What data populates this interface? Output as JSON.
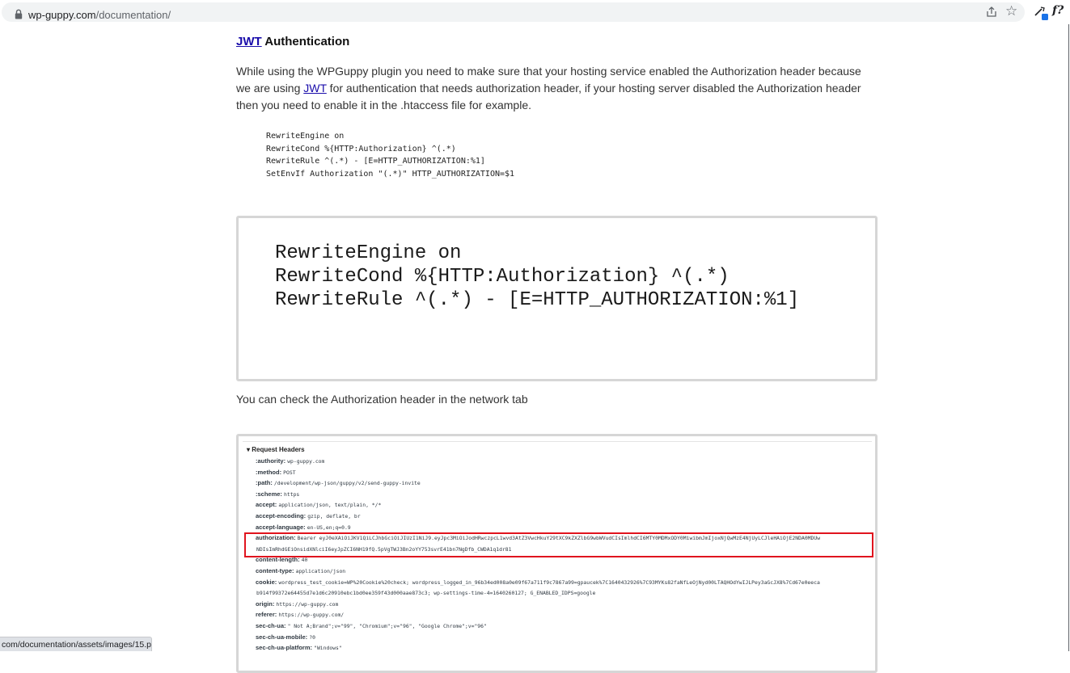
{
  "browser": {
    "url_domain": "wp-guppy.com",
    "url_path": "/documentation/",
    "status_link": "com/documentation/assets/images/15.png"
  },
  "article": {
    "heading_link": "JWT",
    "heading_rest": " Authentication",
    "para1_a": "While using the WPGuppy plugin you need to make sure that your hosting service enabled the Authorization header because we are using ",
    "para1_link": "JWT",
    "para1_b": " for authentication that needs authorization header, if your hosting server disabled the Authorization header then you need to enable it in the .htaccess file for example.",
    "code": "RewriteEngine on\nRewriteCond %{HTTP:Authorization} ^(.*)\nRewriteRule ^(.*) - [E=HTTP_AUTHORIZATION:%1]\nSetEnvIf Authorization \"(.*)\" HTTP_AUTHORIZATION=$1",
    "image1_code": "RewriteEngine on\nRewriteCond %{HTTP:Authorization} ^(.*)\nRewriteRule ^(.*) - [E=HTTP_AUTHORIZATION:%1]",
    "para2": "You can check the Authorization header in the network tab"
  },
  "request_headers": {
    "title": "▾ Request Headers",
    "rows": [
      {
        "name": ":authority:",
        "value": "wp-guppy.com"
      },
      {
        "name": ":method:",
        "value": "POST"
      },
      {
        "name": ":path:",
        "value": "/development/wp-json/guppy/v2/send-guppy-invite"
      },
      {
        "name": ":scheme:",
        "value": "https"
      },
      {
        "name": "accept:",
        "value": "application/json, text/plain, */*"
      },
      {
        "name": "accept-encoding:",
        "value": "gzip, deflate, br"
      },
      {
        "name": "accept-language:",
        "value": "en-US,en;q=0.9"
      },
      {
        "name": "authorization:",
        "value": "Bearer eyJ0eXAiOiJKV1QiLCJhbGciOiJIUzI1NiJ9.eyJpc3MiOiJodHRwczpcL1wvd3AtZ3VwcHkuY29tXC9kZXZlbG9wbWVudCIsImlhdCI6MTY0MDMxODY0MiwibmJmIjoxNjQwMzE4NjUyLCJleHAiOjE2NDA0MDUw"
      },
      {
        "name": "",
        "value": "NDIsImRhdGEiOnsidXNlciI6eyJpZCI6NH19fQ.5pVgTWJ3Bn2oYY753svrE41bn7NgDfb_CWDA1q1dr81"
      },
      {
        "name": "content-length:",
        "value": "40"
      },
      {
        "name": "content-type:",
        "value": "application/json"
      },
      {
        "name": "cookie:",
        "value": "wordpress_test_cookie=WP%20Cookie%20check; wordpress_logged_in_96b34ed008a0e09f67a711f9c7867a99=gpaucek%7C1640432926%7C93MYKs82faNfLeOjNyd00LTAQHOdYwIJLPey3aGcJX8%7Cd67e0eeca"
      },
      {
        "name": "",
        "value": "b914f99372e64455d7e1d6c20910ebc1bd0ee359f43d000aae873c3; wp-settings-time-4=1640260127; G_ENABLED_IDPS=google"
      },
      {
        "name": "origin:",
        "value": "https://wp-guppy.com"
      },
      {
        "name": "referer:",
        "value": "https://wp-guppy.com/"
      },
      {
        "name": "sec-ch-ua:",
        "value": "\" Not A;Brand\";v=\"99\", \"Chromium\";v=\"96\", \"Google Chrome\";v=\"96\""
      },
      {
        "name": "sec-ch-ua-mobile:",
        "value": "?0"
      },
      {
        "name": "sec-ch-ua-platform:",
        "value": "\"Windows\""
      }
    ]
  },
  "icons": [
    "lock-icon",
    "share-icon",
    "star-icon",
    "extensions-icon",
    "fx-icon"
  ]
}
